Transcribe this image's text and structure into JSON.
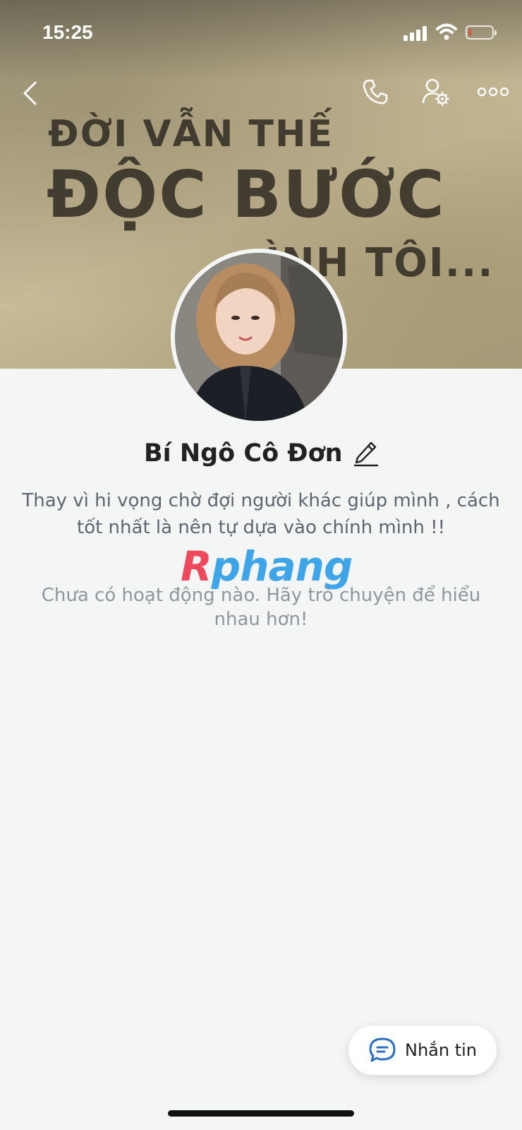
{
  "status_bar": {
    "time": "15:25"
  },
  "cover": {
    "lines": [
      "ĐỜI VẪN THẾ",
      "ĐỘC BƯỚC",
      "ÌNH TÔI..."
    ]
  },
  "profile": {
    "name": "Bí Ngô Cô Đơn",
    "bio": "Thay vì hi vọng chờ đợi người khác giúp mình , cách tốt nhất là nên tự dựa vào chính mình !!",
    "empty_state": "Chưa có hoạt động nào. Hãy trò chuyện để hiểu nhau hơn!"
  },
  "watermark": {
    "first": "R",
    "rest": "phang"
  },
  "message_button": {
    "label": "Nhắn tin"
  },
  "icons": {
    "back": "back-icon",
    "call": "phone-icon",
    "settings": "user-settings-icon",
    "more": "more-icon",
    "edit": "pencil-icon",
    "message": "chat-bubble-icon"
  },
  "colors": {
    "accent": "#2b6fc5",
    "watermark_red": "#ee4a5d",
    "watermark_blue": "#3ea5e8"
  }
}
